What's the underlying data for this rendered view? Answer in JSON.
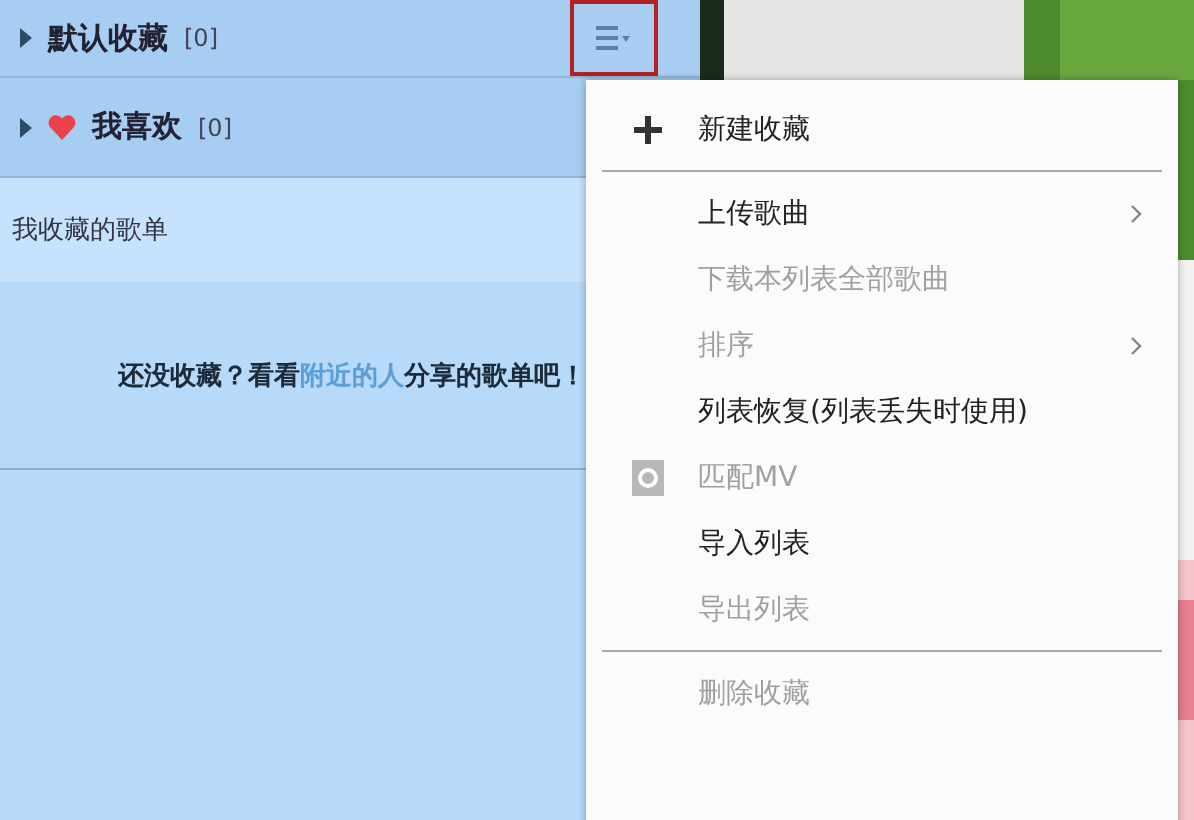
{
  "playlists": [
    {
      "name": "默认收藏",
      "count": "[0]",
      "liked": false,
      "expanded": false
    },
    {
      "name": "我喜欢",
      "count": "[0]",
      "liked": true,
      "expanded": false
    }
  ],
  "section_title": "我收藏的歌单",
  "empty_message_parts": [
    "还没收藏？看看",
    "附近的人",
    "分享的歌单吧！"
  ],
  "menu": [
    {
      "kind": "add_item",
      "label": "新建收藏",
      "disabled": false,
      "submenu": false
    },
    {
      "kind": "separator"
    },
    {
      "kind": "item",
      "label": "上传歌曲",
      "disabled": false,
      "submenu": true
    },
    {
      "kind": "item",
      "label": "下载本列表全部歌曲",
      "disabled": true,
      "submenu": false
    },
    {
      "kind": "item",
      "label": "排序",
      "disabled": true,
      "submenu": true
    },
    {
      "kind": "item",
      "label": "列表恢复(列表丢失时使用)",
      "disabled": false,
      "submenu": false
    },
    {
      "kind": "mv_item",
      "label": "匹配MV",
      "disabled": true,
      "submenu": false
    },
    {
      "kind": "item",
      "label": "导入列表",
      "disabled": false,
      "submenu": false
    },
    {
      "kind": "item",
      "label": "导出列表",
      "disabled": true,
      "submenu": false
    },
    {
      "kind": "separator"
    },
    {
      "kind": "item",
      "label": "删除收藏",
      "disabled": true,
      "submenu": false
    }
  ]
}
